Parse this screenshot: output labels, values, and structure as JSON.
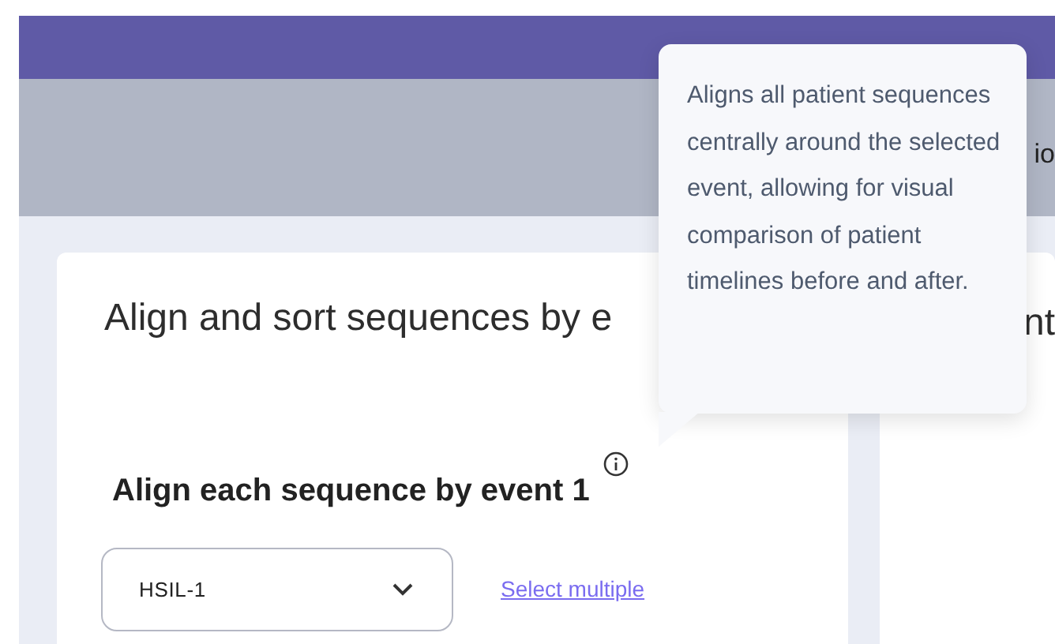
{
  "header_tab_fragment": "io",
  "card": {
    "title": "Align and sort sequences by",
    "title_fragment": "e",
    "section_heading": "Align each sequence by event 1",
    "select": {
      "value": "HSIL-1"
    },
    "link": "Select multiple"
  },
  "side_card": {
    "title_fragment": "nt"
  },
  "tooltip": {
    "text": "Aligns all patient sequences centrally around the selected event, allowing for visual comparison of patient timelines before and after."
  }
}
